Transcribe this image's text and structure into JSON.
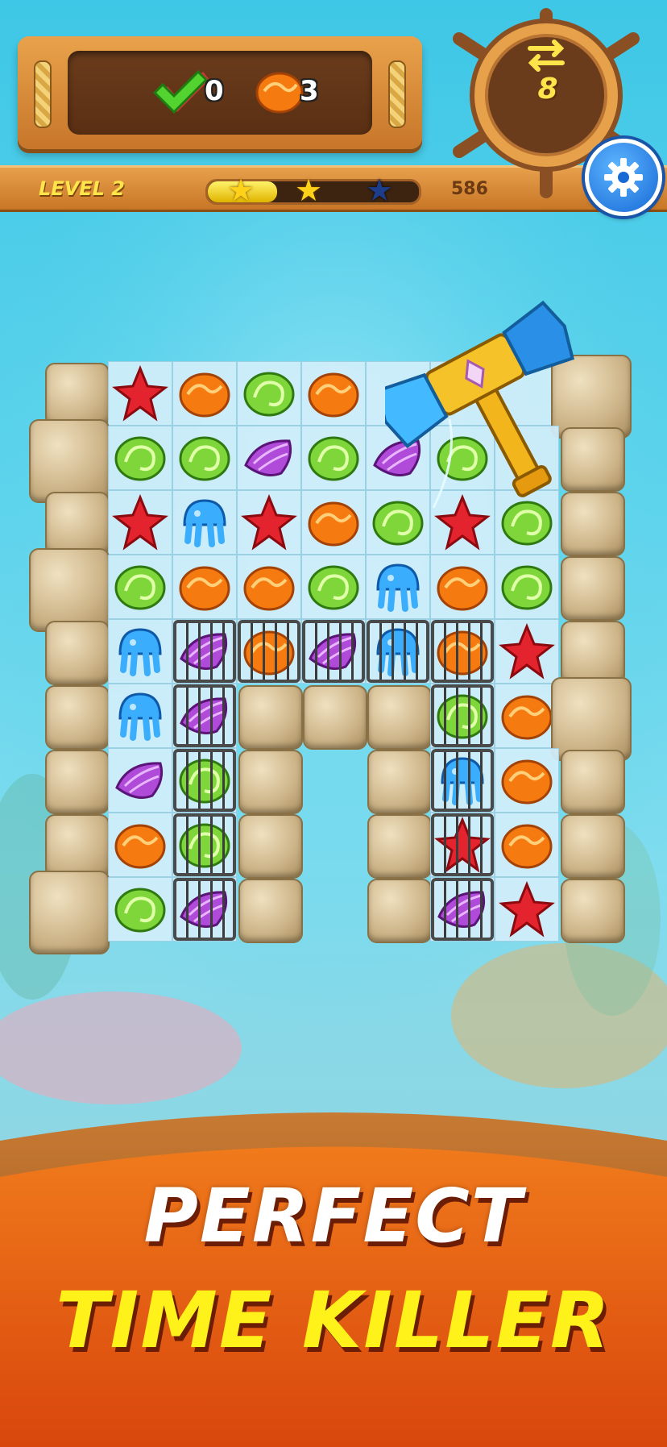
{
  "goals": [
    {
      "icon": "green-check-icon",
      "count": "0"
    },
    {
      "icon": "orange-shell-icon",
      "count": "3"
    }
  ],
  "moves": {
    "value": "8",
    "icon": "swap-arrows-icon"
  },
  "level": {
    "label": "LEVEL 2"
  },
  "score": {
    "value": "586"
  },
  "progress": {
    "fraction": 0.33,
    "stars_earned": 2,
    "stars_total": 3
  },
  "board": {
    "cols": 9,
    "rows": 9,
    "grid": [
      [
        "rock",
        "starfish",
        "orange",
        "green",
        "orange",
        "",
        "",
        "",
        "rock"
      ],
      [
        "rock",
        "green",
        "green",
        "purple",
        "green",
        "purple",
        "green",
        "",
        "rock"
      ],
      [
        "rock",
        "starfish",
        "jelly",
        "starfish",
        "orange",
        "green",
        "starfish",
        "green",
        "rock"
      ],
      [
        "rock",
        "green",
        "orange",
        "orange",
        "green",
        "jelly",
        "orange",
        "green",
        "rock"
      ],
      [
        "rock",
        "jelly",
        "c-purple",
        "c-orange",
        "c-purple",
        "c-jelly",
        "c-orange",
        "starfish",
        "rock"
      ],
      [
        "rock",
        "jelly",
        "c-purple",
        "rock",
        "rock",
        "rock",
        "c-green",
        "orange",
        "rock"
      ],
      [
        "rock",
        "purple",
        "c-green",
        "rock",
        "gap",
        "rock",
        "c-jelly",
        "orange",
        "rock"
      ],
      [
        "rock",
        "orange",
        "c-green",
        "rock",
        "gap",
        "rock",
        "c-starfish",
        "orange",
        "rock"
      ],
      [
        "rock",
        "green",
        "c-purple",
        "rock",
        "gap",
        "rock",
        "c-purple",
        "starfish",
        "rock"
      ]
    ]
  },
  "booster": {
    "icon": "hammer-icon"
  },
  "settings": {
    "icon": "gear-icon"
  },
  "tagline": {
    "line1": "PERFECT",
    "line2": "TIME KILLER"
  },
  "colors": {
    "accent": "#ffe44a",
    "banner": "#e25a12",
    "wood": "#c77626"
  }
}
